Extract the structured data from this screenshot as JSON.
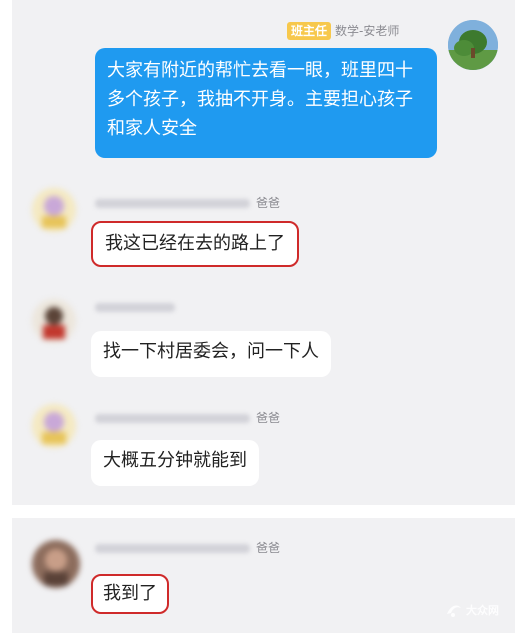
{
  "teacher": {
    "role_badge": "班主任",
    "name": "数学-安老师",
    "message": "大家有附近的帮忙去看一眼，班里四十多个孩子，我抽不开身。主要担心孩子和家人安全"
  },
  "messages": [
    {
      "name_suffix": "爸爸",
      "text": "我这已经在去的路上了"
    },
    {
      "name_suffix": "",
      "text": "找一下村居委会，问一下人"
    },
    {
      "name_suffix": "爸爸",
      "text": "大概五分钟就能到"
    },
    {
      "name_suffix": "爸爸",
      "text": "我到了"
    }
  ],
  "colors": {
    "outgoing_bubble": "#1f9af0",
    "highlight": "#cf2a2a",
    "badge": "#f7c84c",
    "background": "#f1f1f3"
  },
  "watermark": "大众网"
}
